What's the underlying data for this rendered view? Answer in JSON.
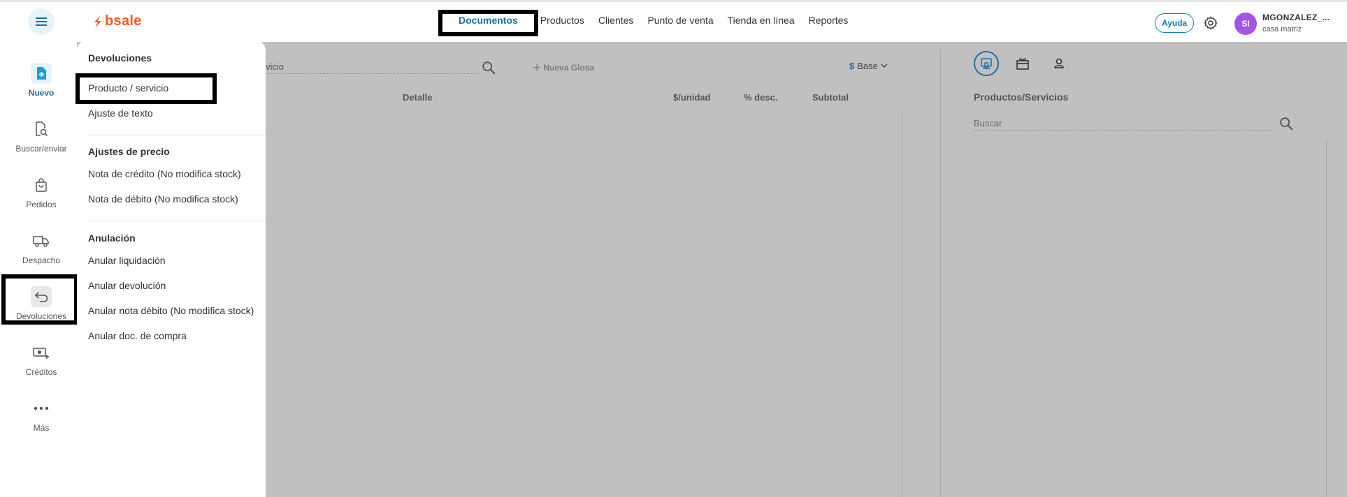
{
  "brand": {
    "name": "bsale",
    "color": "#ff5a1f"
  },
  "accent_color": "#1c6da6",
  "topnav": {
    "items": [
      "Documentos",
      "Productos",
      "Clientes",
      "Punto de venta",
      "Tienda en línea",
      "Reportes"
    ],
    "active": "Documentos"
  },
  "header": {
    "help_label": "Ayuda",
    "avatar_initials": "SI",
    "user_name": "MGONZALEZ_...",
    "user_branch": "casa matriz",
    "icons": [
      "menu-icon",
      "gear-icon"
    ]
  },
  "sidebar": {
    "items": [
      {
        "label": "Nuevo",
        "icon": "new-document-icon"
      },
      {
        "label": "Buscar/enviar",
        "icon": "document-search-icon"
      },
      {
        "label": "Pedidos",
        "icon": "shopping-bag-icon"
      },
      {
        "label": "Despacho",
        "icon": "truck-icon"
      },
      {
        "label": "Devoluciones",
        "icon": "return-arrow-icon"
      },
      {
        "label": "Créditos",
        "icon": "money-icon"
      },
      {
        "label": "Más",
        "icon": "more-dots-icon"
      }
    ]
  },
  "menu": {
    "sections": [
      {
        "title": "Devoluciones",
        "items": [
          "Producto / servicio",
          "Ajuste de texto"
        ]
      },
      {
        "title": "Ajustes de precio",
        "items": [
          "Nota de crédito (No modifica stock)",
          "Nota de débito (No modifica stock)"
        ]
      },
      {
        "title": "Anulación",
        "items": [
          "Anular liquidación",
          "Anular devolución",
          "Anular nota débito (No modifica stock)",
          "Anular doc. de compra"
        ]
      }
    ]
  },
  "document": {
    "search_partial": "vicio",
    "new_gloss_label": "Nueva Glosa",
    "currency_symbol": "$",
    "currency_label": "Base",
    "columns": [
      "Detalle",
      "$/unidad",
      "% desc.",
      "Subtotal"
    ]
  },
  "products_panel": {
    "title": "Productos/Servicios",
    "search_placeholder": "Buscar",
    "tab_icons": [
      "pos-terminal-icon",
      "gift-icon",
      "person-icon"
    ]
  }
}
